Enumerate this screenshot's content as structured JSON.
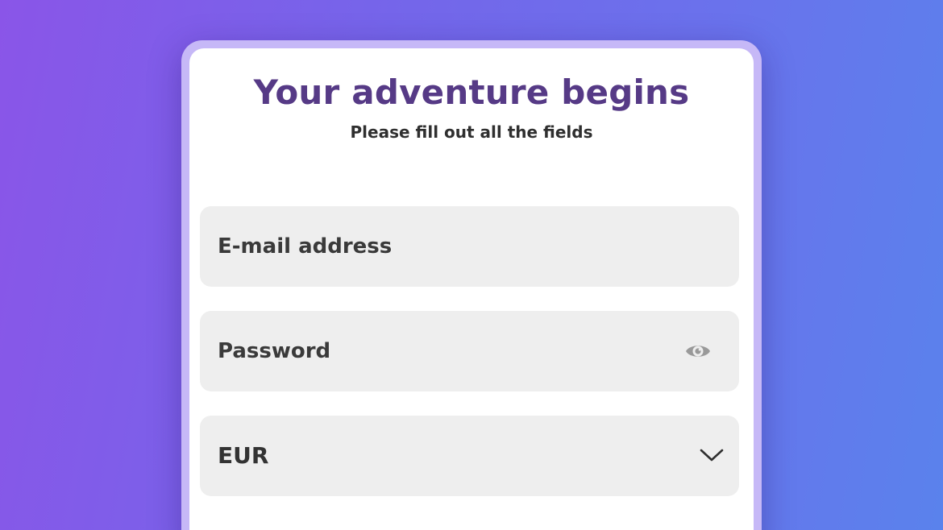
{
  "header": {
    "title": "Your adventure begins",
    "subtitle": "Please fill out all the fields"
  },
  "form": {
    "email": {
      "placeholder": "E-mail address",
      "value": ""
    },
    "password": {
      "placeholder": "Password",
      "value": "",
      "toggle_icon": "eye-icon"
    },
    "currency": {
      "selected": "EUR",
      "dropdown_icon": "chevron-down-icon"
    }
  },
  "colors": {
    "background_gradient_start": "#8a55e8",
    "background_gradient_end": "#5a82ec",
    "title": "#563a86",
    "field_background": "#eeeeee",
    "card_frame": "#c6b8f7"
  }
}
